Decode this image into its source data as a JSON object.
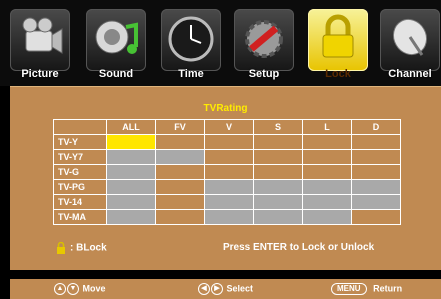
{
  "menu": {
    "tabs": [
      {
        "label": "Picture",
        "icon": "camcorder-icon"
      },
      {
        "label": "Sound",
        "icon": "speaker-music-icon"
      },
      {
        "label": "Time",
        "icon": "clock-icon"
      },
      {
        "label": "Setup",
        "icon": "tools-icon"
      },
      {
        "label": "Lock",
        "icon": "padlock-icon",
        "active": true
      },
      {
        "label": "Channel",
        "icon": "satellite-dish-icon"
      }
    ]
  },
  "tvrating": {
    "title": "TVRating",
    "columns": [
      "ALL",
      "FV",
      "V",
      "S",
      "L",
      "D"
    ],
    "rows": [
      {
        "label": "TV-Y"
      },
      {
        "label": "TV-Y7"
      },
      {
        "label": "TV-G"
      },
      {
        "label": "TV-PG"
      },
      {
        "label": "TV-14"
      },
      {
        "label": "TV-MA"
      }
    ],
    "legend": ": BLock",
    "hint": "Press ENTER to Lock or Unlock"
  },
  "footer": {
    "move": "Move",
    "select": "Select",
    "menu_key": "MENU",
    "return": "Return"
  },
  "colors": {
    "panel": "#c08a52",
    "blocked": "#a9a9a9",
    "selected": "#ffe600",
    "title": "#ffec00"
  }
}
